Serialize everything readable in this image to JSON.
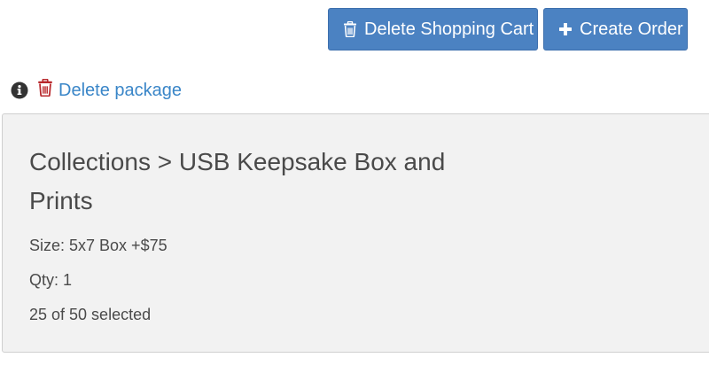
{
  "toolbar": {
    "delete_cart_label": "Delete Shopping Cart",
    "delete_cart_icon": "trash-icon",
    "create_order_label": "Create Order",
    "create_order_icon": "plus-icon"
  },
  "package_actions": {
    "info_icon": "info-circle-icon",
    "delete_icon": "trash-icon",
    "delete_label": "Delete package"
  },
  "package": {
    "title": "Collections > USB Keepsake Box and Prints",
    "size": "Size: 5x7 Box +$75",
    "qty": "Qty: 1",
    "selection": "25 of 50 selected"
  },
  "colors": {
    "button_bg": "#4b82c2",
    "link": "#3a86c8",
    "danger_icon": "#b8282c",
    "panel_bg": "#f2f2f2",
    "text": "#4a4a4a"
  }
}
